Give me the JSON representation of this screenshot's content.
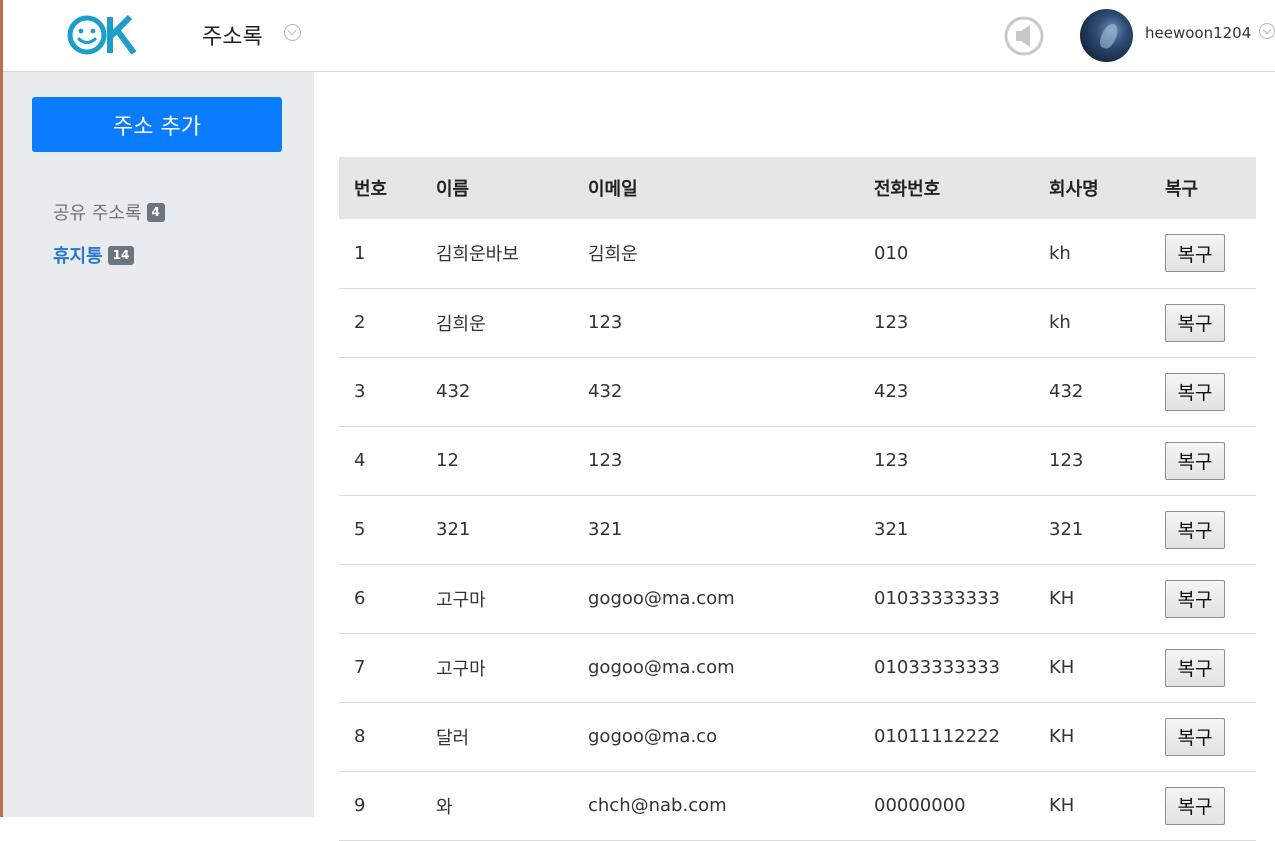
{
  "header": {
    "logo_text": "OK",
    "app_title": "주소록",
    "username": "heewoon1204"
  },
  "sidebar": {
    "add_button": "주소 추가",
    "items": [
      {
        "label": "공유 주소록",
        "count": "4"
      },
      {
        "label": "휴지통",
        "count": "14"
      }
    ]
  },
  "table": {
    "columns": [
      "번호",
      "이름",
      "이메일",
      "전화번호",
      "회사명",
      "복구"
    ],
    "rows": [
      {
        "no": "1",
        "name": "김희운바보",
        "email": "김희운",
        "phone": "010",
        "company": "kh",
        "action": "복구"
      },
      {
        "no": "2",
        "name": "김희운",
        "email": "123",
        "phone": "123",
        "company": "kh",
        "action": "복구"
      },
      {
        "no": "3",
        "name": "432",
        "email": "432",
        "phone": "423",
        "company": "432",
        "action": "복구"
      },
      {
        "no": "4",
        "name": "12",
        "email": "123",
        "phone": "123",
        "company": "123",
        "action": "복구"
      },
      {
        "no": "5",
        "name": "321",
        "email": "321",
        "phone": "321",
        "company": "321",
        "action": "복구"
      },
      {
        "no": "6",
        "name": "고구마",
        "email": "gogoo@ma.com",
        "phone": "01033333333",
        "company": "KH",
        "action": "복구"
      },
      {
        "no": "7",
        "name": "고구마",
        "email": "gogoo@ma.com",
        "phone": "01033333333",
        "company": "KH",
        "action": "복구"
      },
      {
        "no": "8",
        "name": "달러",
        "email": "gogoo@ma.co",
        "phone": "01011112222",
        "company": "KH",
        "action": "복구"
      },
      {
        "no": "9",
        "name": "와",
        "email": "chch@nab.com",
        "phone": "00000000",
        "company": "KH",
        "action": "복구"
      }
    ]
  },
  "colors": {
    "accent": "#0a7cff",
    "logo": "#1a9fc9",
    "sidebar_bg": "#e9ecef",
    "active_item": "#2a77c9",
    "badge": "#6c757d"
  }
}
